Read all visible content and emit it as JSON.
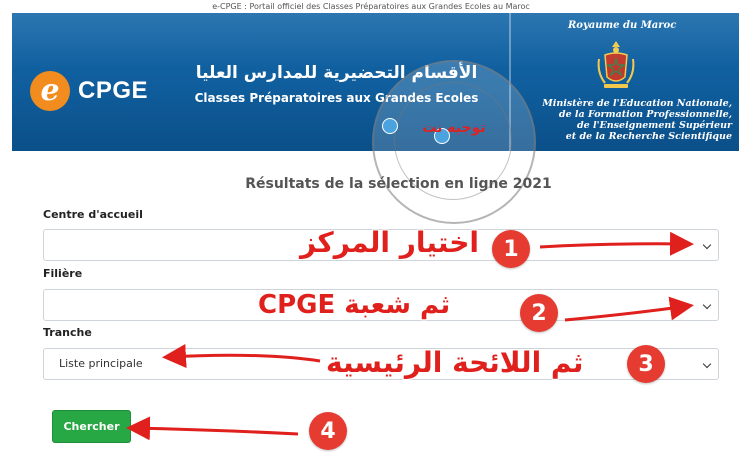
{
  "top_caption": "e-CPGE : Portail officiel des Classes Préparatoires aux Grandes Ecoles au Maroc",
  "banner": {
    "logo_letter": "e",
    "logo_text": "CPGE",
    "title_arabic": "الأقسام التحضيرية للمدارس العليا",
    "title_french": "Classes Préparatoires aux Grandes Ecoles",
    "kingdom": "Royaume du Maroc",
    "ministry_lines": [
      "Ministère de l'Education Nationale,",
      "de la Formation Professionnelle,",
      "de l'Enseignement Supérieur",
      "et de la Recherche Scientifique"
    ],
    "watermark_text": "توجيه نت"
  },
  "page_title": "Résultats de la sélection en ligne 2021",
  "form": {
    "centre_label": "Centre d'accueil",
    "centre_value": "",
    "filiere_label": "Filière",
    "filiere_value": "",
    "tranche_label": "Tranche",
    "tranche_value": "Liste principale",
    "search_label": "Chercher"
  },
  "annotations": [
    {
      "number": "1",
      "text": "اختيار المركز"
    },
    {
      "number": "2",
      "text": "ثم شعبة CPGE"
    },
    {
      "number": "3",
      "text": "ثم اللائحة الرئيسية"
    },
    {
      "number": "4",
      "text": ""
    }
  ],
  "colors": {
    "banner_blue": "#1467a8",
    "logo_orange": "#f28c1e",
    "button_green": "#28a745",
    "annotation_red": "#e0201c",
    "badge_red": "#e53b30"
  },
  "icons": [
    "chevron-down-icon",
    "morocco-emblem-icon",
    "arrow-icon"
  ]
}
